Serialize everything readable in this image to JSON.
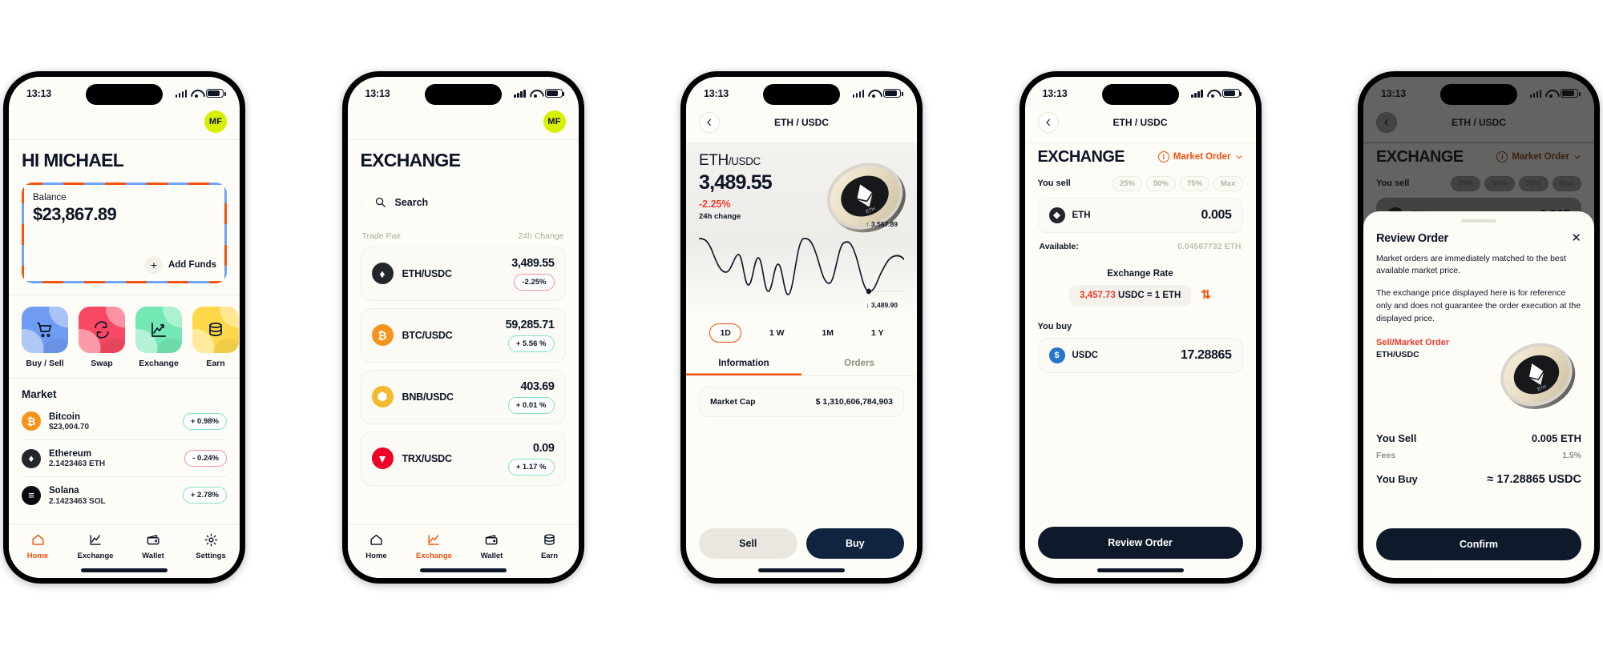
{
  "status_bar": {
    "time": "13:13"
  },
  "colors": {
    "accent_orange": "#F4520E",
    "accent_blue": "#6FA3F5",
    "green": "#7FE3BE",
    "red": "#F23B2F",
    "dark_navy": "#10243F",
    "avatar_lime": "#D7F000"
  },
  "screen1": {
    "avatar_initials": "MF",
    "greeting": "HI MICHAEL",
    "balance_label": "Balance",
    "balance_value": "$23,867.89",
    "add_funds_label": "Add Funds",
    "quick_actions": [
      {
        "label": "Buy / Sell",
        "icon": "cart-icon"
      },
      {
        "label": "Swap",
        "icon": "swap-icon"
      },
      {
        "label": "Exchange",
        "icon": "chart-icon"
      },
      {
        "label": "Earn",
        "icon": "coins-icon"
      }
    ],
    "market_title": "Market",
    "market": [
      {
        "name": "Bitcoin",
        "sub": "$23,004.70",
        "change": "+ 0.98%",
        "dir": "up",
        "sym": "₿"
      },
      {
        "name": "Ethereum",
        "sub": "2.1423463 ETH",
        "change": "- 0.24%",
        "dir": "down",
        "sym": "♦"
      },
      {
        "name": "Solana",
        "sub": "2.1423463 SOL",
        "change": "+ 2.78%",
        "dir": "up",
        "sym": "≡"
      }
    ],
    "tabs": [
      {
        "label": "Home",
        "icon": "home-icon",
        "active": true
      },
      {
        "label": "Exchange",
        "icon": "chart-icon",
        "active": false
      },
      {
        "label": "Wallet",
        "icon": "wallet-icon",
        "active": false
      },
      {
        "label": "Settings",
        "icon": "gear-icon",
        "active": false
      }
    ]
  },
  "screen2": {
    "avatar_initials": "MF",
    "title": "EXCHANGE",
    "search_placeholder": "Search",
    "col_pair": "Trade Pair",
    "col_change": "24h Change",
    "pairs": [
      {
        "name": "ETH/USDC",
        "price": "3,489.55",
        "change": "-2.25%",
        "dir": "down",
        "sym": "♦"
      },
      {
        "name": "BTC/USDC",
        "price": "59,285.71",
        "change": "+ 5.56 %",
        "dir": "up",
        "sym": "₿"
      },
      {
        "name": "BNB/USDC",
        "price": "403.69",
        "change": "+ 0.01 %",
        "dir": "up",
        "sym": "⬢"
      },
      {
        "name": "TRX/USDC",
        "price": "0.09",
        "change": "+ 1.17 %",
        "dir": "up",
        "sym": "▼"
      }
    ],
    "tabs": [
      {
        "label": "Home",
        "icon": "home-icon",
        "active": false
      },
      {
        "label": "Exchange",
        "icon": "chart-icon",
        "active": true
      },
      {
        "label": "Wallet",
        "icon": "wallet-icon",
        "active": false
      },
      {
        "label": "Earn",
        "icon": "coins-icon",
        "active": false
      }
    ]
  },
  "screen3": {
    "nav_title": "ETH / USDC",
    "back_icon": "chevron-left-icon",
    "pair_base": "ETH",
    "pair_quote": "/USDC",
    "price": "3,489.55",
    "change": "-2.25%",
    "change_label": "24h change",
    "coin_label": "ETH",
    "high_label": "↑ 3,567.89",
    "low_label": "↓ 3,489.90",
    "ranges": [
      {
        "label": "1D",
        "active": true
      },
      {
        "label": "1 W",
        "active": false
      },
      {
        "label": "1M",
        "active": false
      },
      {
        "label": "1 Y",
        "active": false
      }
    ],
    "subtabs": [
      {
        "label": "Information",
        "active": true
      },
      {
        "label": "Orders",
        "active": false
      }
    ],
    "info_key": "Market Cap",
    "info_value": "$ 1,310,606,784,903",
    "sell_label": "Sell",
    "buy_label": "Buy",
    "chart_data": {
      "type": "line",
      "title": "ETH/USDC price",
      "xlabel": "",
      "ylabel": "",
      "ylim": [
        3489.9,
        3567.89
      ],
      "annotations": [
        "↑ 3,567.89",
        "↓ 3,489.90"
      ],
      "x": [
        0,
        5,
        10,
        14,
        18,
        22,
        26,
        30,
        34,
        38,
        42,
        46,
        50,
        54,
        58,
        62,
        66,
        70,
        74,
        78,
        82,
        86,
        90,
        94,
        100
      ],
      "y": [
        3560,
        3558,
        3540,
        3500,
        3520,
        3496,
        3530,
        3492,
        3512,
        3496,
        3556,
        3558,
        3540,
        3502,
        3496,
        3540,
        3556,
        3552,
        3520,
        3496,
        3492,
        3500,
        3528,
        3546,
        3530
      ]
    }
  },
  "screen4": {
    "nav_title": "ETH / USDC",
    "back_icon": "chevron-left-icon",
    "title": "EXCHANGE",
    "order_type": "Market Order",
    "order_info_icon": "info-icon",
    "order_chevron_icon": "chevron-down-icon",
    "you_sell_label": "You sell",
    "percents": [
      "25%",
      "50%",
      "75%",
      "Max"
    ],
    "sell_symbol": "ETH",
    "sell_amount": "0.005",
    "available_label": "Available:",
    "available_value": "0.04567732 ETH",
    "rate_title": "Exchange Rate",
    "rate_amount": "3,457.73",
    "rate_rest": "USDC = 1 ETH",
    "swap_icon": "swap-vertical-icon",
    "you_buy_label": "You buy",
    "buy_symbol": "USDC",
    "buy_amount": "17.28865",
    "cta": "Review Order"
  },
  "screen5": {
    "nav_title": "ETH / USDC",
    "title": "EXCHANGE",
    "order_type": "Market Order",
    "you_sell_label": "You sell",
    "percents": [
      "25%",
      "50%",
      "75%",
      "Max"
    ],
    "sell_symbol": "ETH",
    "sell_amount": "0.005",
    "sheet": {
      "title": "Review Order",
      "close_icon": "close-icon",
      "paragraph1": "Market orders are immediately matched to the best available market price.",
      "paragraph2": "The exchange price displayed here is for reference only and does not guarantee the order execution at the displayed price.",
      "order_kind": "Sell/Market Order",
      "order_pair": "ETH/USDC",
      "coin_label": "ETH",
      "you_sell_label": "You Sell",
      "you_sell_value": "0.005 ETH",
      "fees_label": "Fees",
      "fees_value": "1.5%",
      "you_buy_label": "You Buy",
      "you_buy_value": "≈ 17.28865  USDC",
      "cta": "Confirm"
    }
  }
}
